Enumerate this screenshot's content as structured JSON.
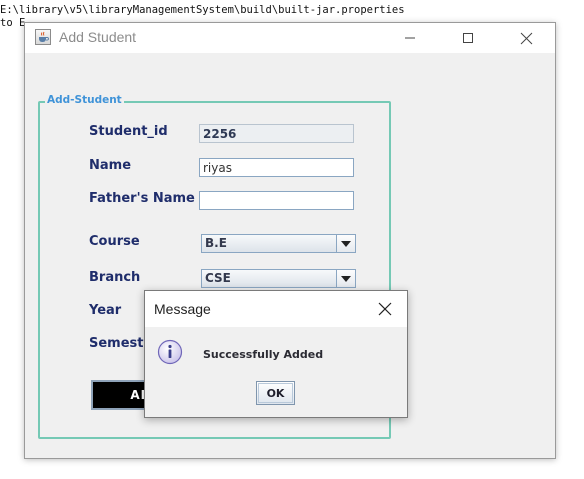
{
  "console": {
    "line1": "E:\\library\\v5\\libraryManagementSystem\\build\\built-jar.properties",
    "line2": "to E"
  },
  "window": {
    "title": "Add Student",
    "app_icon": "java-cup-icon"
  },
  "form": {
    "group_title": "Add-Student",
    "student_id_label": "Student_id",
    "student_id_value": "2256",
    "name_label": "Name",
    "name_value": "riyas",
    "fathers_name_label": "Father's Name",
    "fathers_name_value": "",
    "course_label": "Course",
    "course_value": "B.E",
    "branch_label": "Branch",
    "branch_value": "CSE",
    "year_label": "Year",
    "semester_label": "Semeste",
    "add_button_label": "AD"
  },
  "dialog": {
    "title": "Message",
    "message": "Successfully Added",
    "ok_label": "OK",
    "icon": "info-icon"
  },
  "colors": {
    "label_color": "#1f2d6b",
    "group_border": "#75c9b5",
    "group_title": "#3f93d8"
  }
}
